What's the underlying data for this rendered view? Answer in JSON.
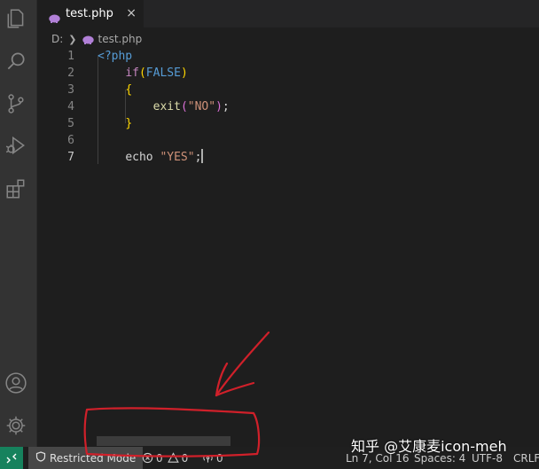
{
  "tab": {
    "label": "test.php",
    "close": "×"
  },
  "breadcrumb": {
    "drive": "D:",
    "file": "test.php"
  },
  "editor": {
    "lines": [
      {
        "n": "1"
      },
      {
        "n": "2"
      },
      {
        "n": "3"
      },
      {
        "n": "4"
      },
      {
        "n": "5"
      },
      {
        "n": "6"
      },
      {
        "n": "7"
      }
    ],
    "code": {
      "open_tag": "<?php",
      "if_kw": "if",
      "paren_open": "(",
      "false_kw": "FALSE",
      "paren_close": ")",
      "brace_open": "{",
      "exit_fn": "exit",
      "exit_paren_open": "(",
      "exit_str": "\"NO\"",
      "exit_paren_close": ")",
      "exit_semi": ";",
      "brace_close": "}",
      "echo_kw": "echo",
      "echo_str": "\"YES\"",
      "echo_semi": ";"
    }
  },
  "status": {
    "restricted": "Restricted Mode",
    "errors": "0",
    "warnings": "0",
    "ports": "0",
    "position": "Ln 7, Col 16",
    "spaces": "Spaces: 4",
    "encoding": "UTF-8",
    "eol": "CRLF"
  },
  "watermark": "知乎 @艾康麦icon-meh",
  "colors": {
    "annotation": "#d0202a",
    "remote_bg": "#16825d",
    "php_icon": "#b180d7"
  },
  "icons": [
    "files-icon",
    "search-icon",
    "source-control-icon",
    "run-debug-icon",
    "extensions-icon",
    "account-icon",
    "settings-gear-icon",
    "php-elephant-icon",
    "remote-icon",
    "shield-icon",
    "error-icon",
    "warning-icon",
    "ports-icon",
    "close-icon",
    "chevron-right-icon"
  ]
}
